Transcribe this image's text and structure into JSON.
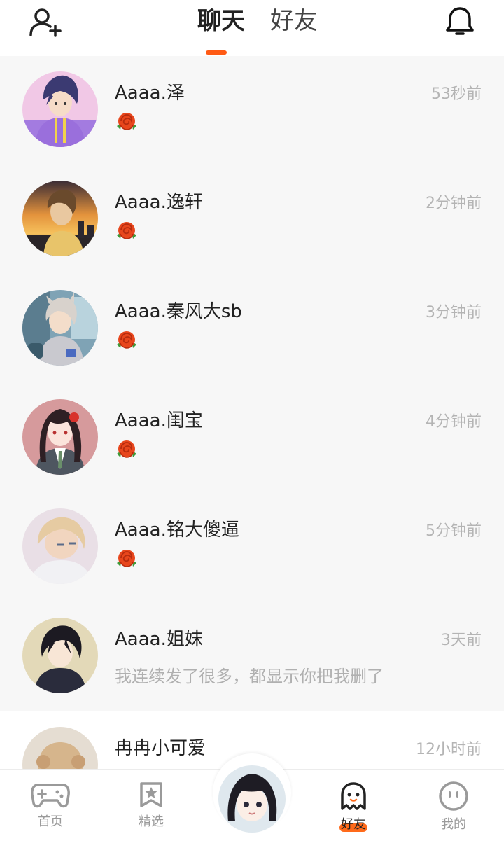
{
  "header": {
    "tabs": [
      {
        "label": "聊天",
        "active": true
      },
      {
        "label": "好友",
        "active": false
      }
    ],
    "accent_color": "#ff5a14"
  },
  "chats": [
    {
      "name": "Aaaa.泽",
      "time": "53秒前",
      "message_type": "rose-icon"
    },
    {
      "name": "Aaaa.逸轩",
      "time": "2分钟前",
      "message_type": "rose-icon"
    },
    {
      "name": "Aaaa.秦风大sb",
      "time": "3分钟前",
      "message_type": "rose-icon"
    },
    {
      "name": "Aaaa.闺宝",
      "time": "4分钟前",
      "message_type": "rose-icon"
    },
    {
      "name": "Aaaa.铭大傻逼",
      "time": "5分钟前",
      "message_type": "rose-icon"
    },
    {
      "name": "Aaaa.姐妹",
      "time": "3天前",
      "preview": "我连续发了很多，都显示你把我删了"
    },
    {
      "name": "冉冉小可爱",
      "time": "12小时前"
    }
  ],
  "bottom_nav": {
    "items": [
      {
        "label": "首页",
        "icon": "gamepad-icon",
        "active": false
      },
      {
        "label": "精选",
        "icon": "star-bookmark-icon",
        "active": false
      },
      {
        "label": "好友",
        "icon": "ghost-icon",
        "active": true
      },
      {
        "label": "我的",
        "icon": "face-icon",
        "active": false
      }
    ]
  }
}
